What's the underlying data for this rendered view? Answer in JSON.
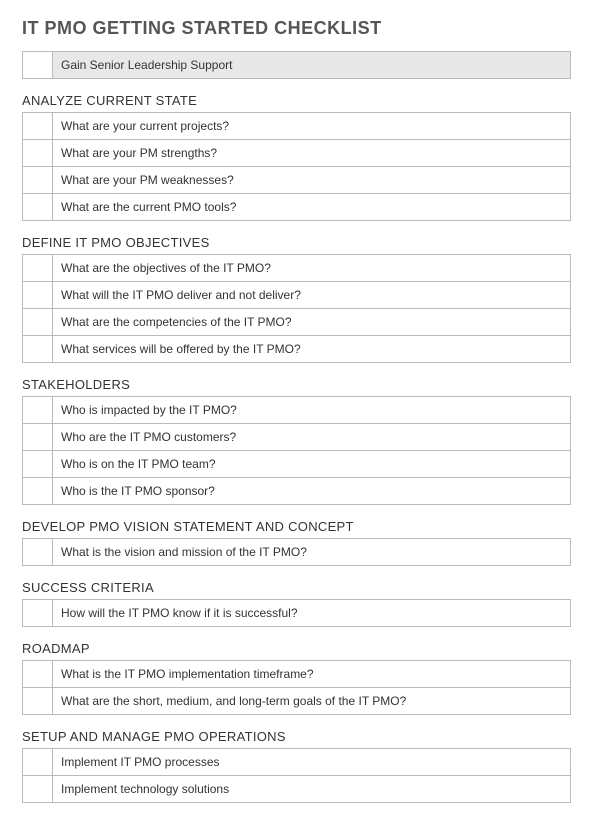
{
  "title": "IT PMO GETTING STARTED CHECKLIST",
  "topItem": "Gain Senior Leadership Support",
  "sections": [
    {
      "heading": "ANALYZE CURRENT STATE",
      "items": [
        "What are your current projects?",
        "What are your PM strengths?",
        "What are your PM weaknesses?",
        "What are the current PMO tools?"
      ]
    },
    {
      "heading": "DEFINE IT PMO OBJECTIVES",
      "items": [
        "What are the objectives of the IT PMO?",
        "What will the IT PMO deliver and not deliver?",
        "What are the competencies of the IT PMO?",
        "What services will be offered by the IT PMO?"
      ]
    },
    {
      "heading": "STAKEHOLDERS",
      "items": [
        "Who is impacted by the IT PMO?",
        "Who are the IT PMO customers?",
        "Who is on the IT PMO team?",
        "Who is the IT PMO sponsor?"
      ]
    },
    {
      "heading": "DEVELOP PMO VISION STATEMENT AND CONCEPT",
      "items": [
        "What is the vision and mission of the IT PMO?"
      ]
    },
    {
      "heading": "SUCCESS CRITERIA",
      "items": [
        "How will the IT PMO know if it is successful?"
      ]
    },
    {
      "heading": "ROADMAP",
      "items": [
        "What is the IT PMO implementation timeframe?",
        "What are the short, medium, and long-term goals of the IT PMO?"
      ]
    },
    {
      "heading": "SETUP AND MANAGE PMO OPERATIONS",
      "items": [
        "Implement IT PMO processes",
        "Implement technology solutions"
      ]
    }
  ]
}
